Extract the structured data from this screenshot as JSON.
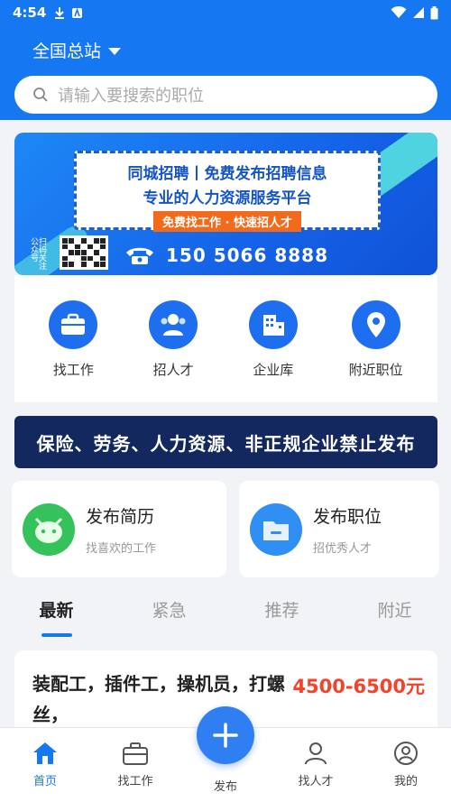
{
  "status": {
    "time": "4:54"
  },
  "header": {
    "region": "全国总站",
    "search_placeholder": "请输入要搜索的职位"
  },
  "banner": {
    "line1": "同城招聘丨免费发布招聘信息",
    "line2": "专业的人力资源服务平台",
    "line3": "免费找工作 · 快速招人才",
    "qr_label": "扫码关注公众号",
    "phone": "150 5066 8888"
  },
  "quick": [
    {
      "label": "找工作",
      "icon": "briefcase-icon"
    },
    {
      "label": "招人才",
      "icon": "people-icon"
    },
    {
      "label": "企业库",
      "icon": "building-icon"
    },
    {
      "label": "附近职位",
      "icon": "location-pin-icon"
    }
  ],
  "notice": "保险、劳务、人力资源、非正规企业禁止发布",
  "cards": [
    {
      "title": "发布简历",
      "sub": "找喜欢的工作",
      "icon": "robot-face-icon",
      "color": "#35c25b"
    },
    {
      "title": "发布职位",
      "sub": "招优秀人才",
      "icon": "folder-icon",
      "color": "#2f8ff2"
    }
  ],
  "tabs": [
    "最新",
    "紧急",
    "推荐",
    "附近"
  ],
  "active_tab": 0,
  "job": {
    "title": "装配工，插件工，操机员，打螺丝，",
    "salary": "4500-6500元"
  },
  "nav": [
    "首页",
    "找工作",
    "发布",
    "找人才",
    "我的"
  ],
  "colors": {
    "primary": "#1677f2",
    "notice_bg": "#13285e",
    "salary": "#f5432b"
  }
}
